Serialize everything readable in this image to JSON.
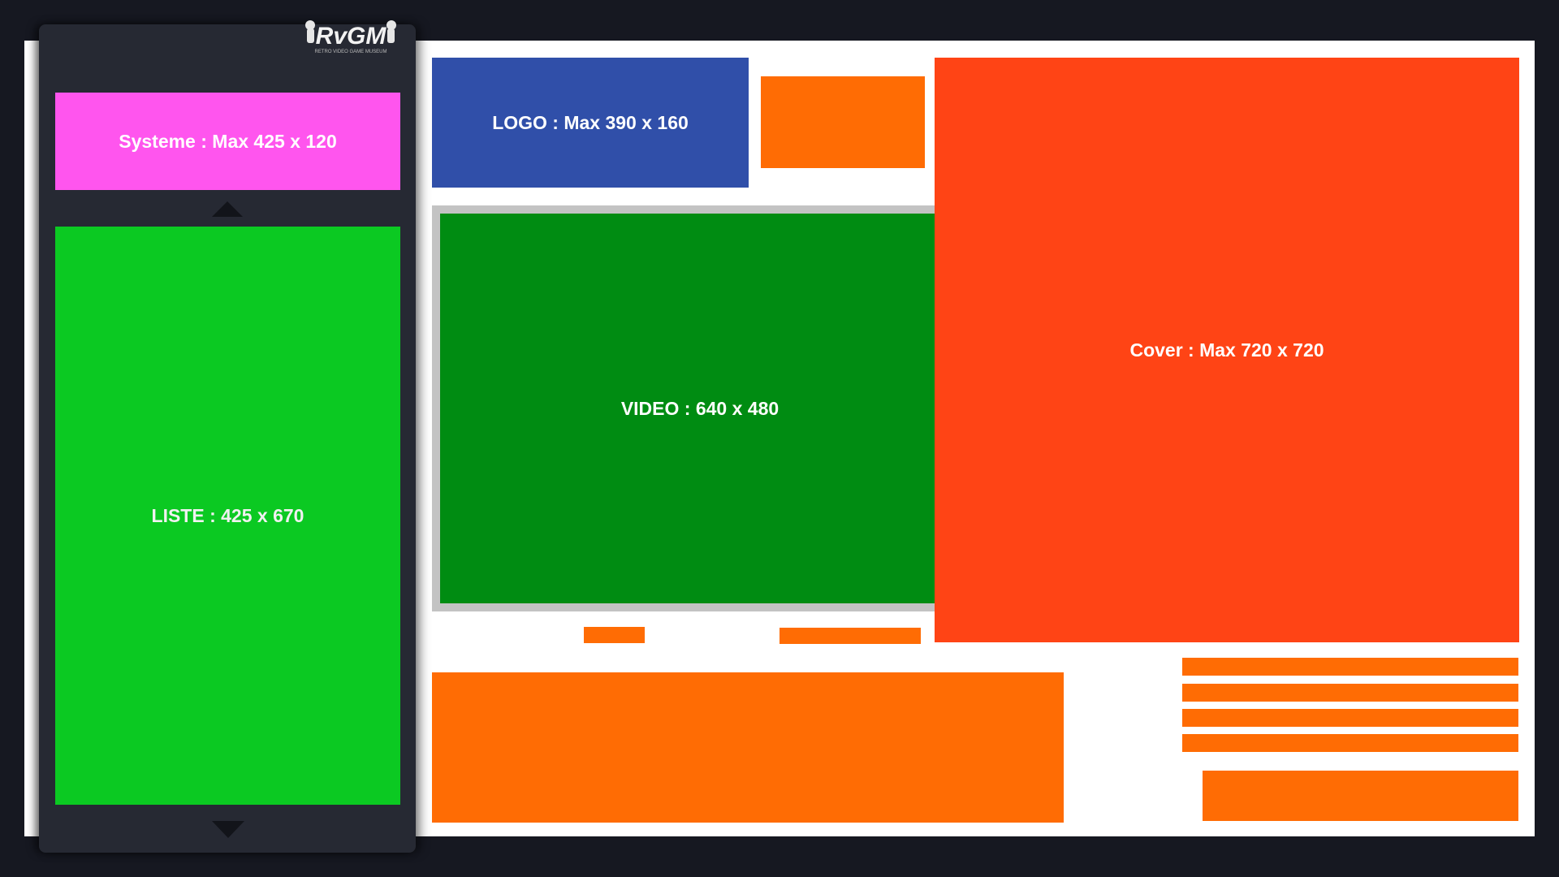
{
  "branding": {
    "logo_icon": "rvgm-logo-icon",
    "logo_text": "RvGM",
    "logo_subtext": "RETRO VIDEO GAME MUSEUM"
  },
  "sidebar": {
    "system_label": "Systeme : Max 425 x 120",
    "list_label": "LISTE : 425 x 670",
    "scroll_up_icon": "triangle-up-icon",
    "scroll_down_icon": "triangle-down-icon"
  },
  "main": {
    "logo_label": "LOGO : Max 390 x 160",
    "video_label": "VIDEO : 640 x 480",
    "cover_label": "Cover : Max 720 x 720"
  },
  "colors": {
    "background": "#161821",
    "sidebar": "#262933",
    "system": "#ff55ee",
    "list": "#0bc922",
    "logo": "#304fa9",
    "video": "#008c12",
    "video_frame": "#c3c3c3",
    "cover": "#ff4415",
    "placeholder": "#ff6c04"
  }
}
